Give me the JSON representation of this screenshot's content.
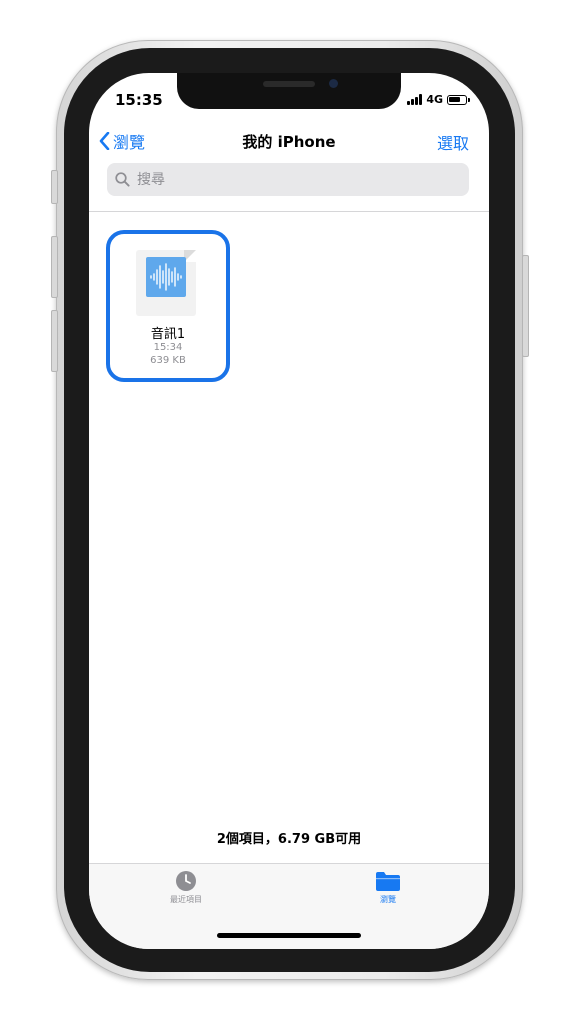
{
  "status_bar": {
    "time": "15:35",
    "network": "4G"
  },
  "nav": {
    "back_label": "瀏覽",
    "title": "我的 iPhone",
    "select_label": "選取"
  },
  "search": {
    "placeholder": "搜尋"
  },
  "files": [
    {
      "name": "音訊1",
      "time": "15:34",
      "size": "639 KB"
    }
  ],
  "footer": {
    "storage_info": "2個項目，6.79 GB可用"
  },
  "tabbar": {
    "recents_label": "最近項目",
    "browse_label": "瀏覽"
  },
  "colors": {
    "accent": "#1779f2",
    "highlight_border": "#1a73e8",
    "waveform": "#5fa8ec"
  },
  "icons": [
    "back-chevron-icon",
    "search-icon",
    "audio-waveform-icon",
    "clock-icon",
    "folder-icon",
    "signal-icon",
    "battery-icon"
  ]
}
